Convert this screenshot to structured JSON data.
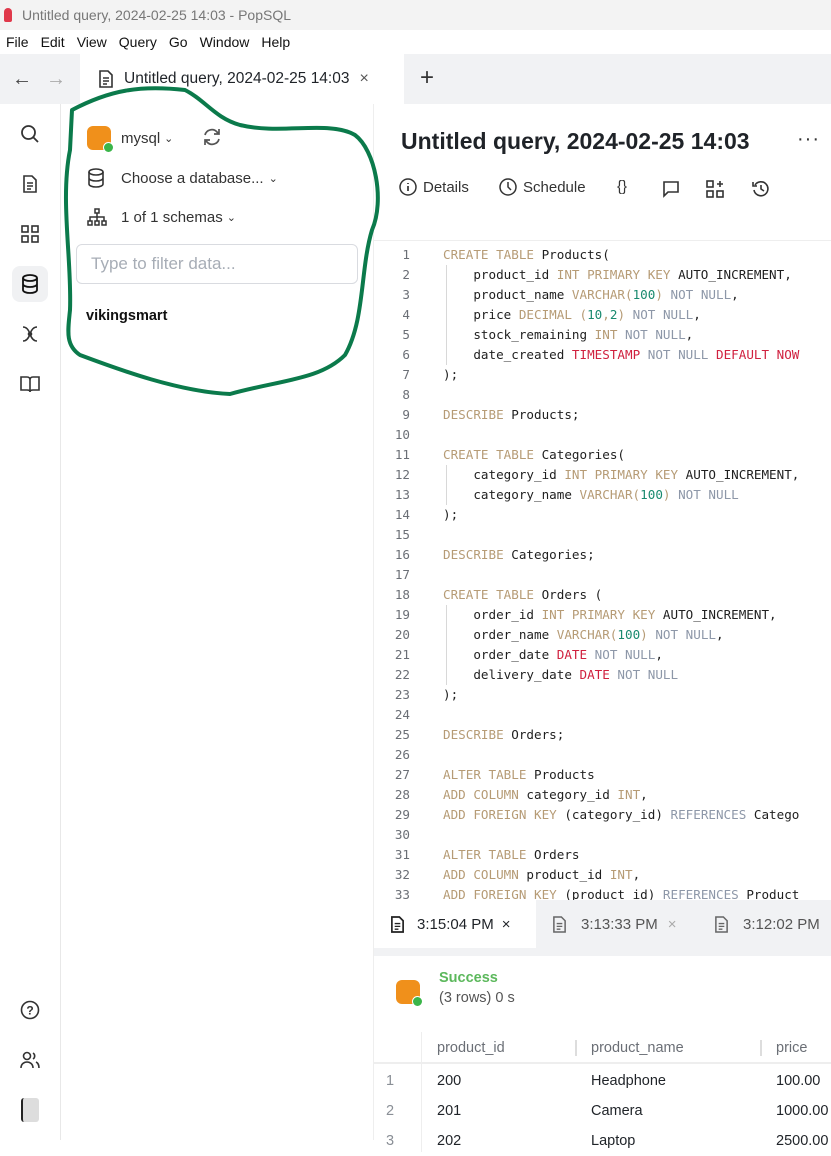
{
  "window": {
    "title": "Untitled query, 2024-02-25 14:03 - PopSQL"
  },
  "menu": [
    "File",
    "Edit",
    "View",
    "Query",
    "Go",
    "Window",
    "Help"
  ],
  "tabs": {
    "active": "Untitled query, 2024-02-25 14:03",
    "close": "×",
    "add": "+"
  },
  "sidebar": {
    "connection": "mysql",
    "database": "Choose a database...",
    "schemas": "1 of 1 schemas",
    "filter_placeholder": "Type to filter data...",
    "schema_item": "vikingsmart"
  },
  "query": {
    "title": "Untitled query, 2024-02-25 14:03",
    "more": "···",
    "toolbar": {
      "details": "Details",
      "schedule": "Schedule",
      "braces": "{}"
    }
  },
  "editor": {
    "lines": [
      [
        [
          "k",
          "CREATE TABLE "
        ],
        [
          "",
          "Products("
        ]
      ],
      [
        [
          "",
          "    product_id "
        ],
        [
          "k",
          "INT PRIMARY KEY "
        ],
        [
          "",
          "AUTO_INCREMENT,"
        ]
      ],
      [
        [
          "",
          "    product_name "
        ],
        [
          "k",
          "VARCHAR("
        ],
        [
          "n",
          "100"
        ],
        [
          "k",
          ") "
        ],
        [
          "g",
          "NOT NULL"
        ],
        [
          "",
          ","
        ]
      ],
      [
        [
          "",
          "    price "
        ],
        [
          "k",
          "DECIMAL ("
        ],
        [
          "n",
          "10"
        ],
        [
          "k",
          ","
        ],
        [
          "n",
          "2"
        ],
        [
          "k",
          ") "
        ],
        [
          "g",
          "NOT NULL"
        ],
        [
          "",
          ","
        ]
      ],
      [
        [
          "",
          "    stock_remaining "
        ],
        [
          "k",
          "INT "
        ],
        [
          "g",
          "NOT NULL"
        ],
        [
          "",
          ","
        ]
      ],
      [
        [
          "",
          "    date_created "
        ],
        [
          "r",
          "TIMESTAMP "
        ],
        [
          "g",
          "NOT NULL "
        ],
        [
          "r",
          "DEFAULT NOW"
        ]
      ],
      [
        [
          "",
          ");"
        ]
      ],
      [],
      [
        [
          "k",
          "DESCRIBE "
        ],
        [
          "",
          "Products;"
        ]
      ],
      [],
      [
        [
          "k",
          "CREATE TABLE "
        ],
        [
          "",
          "Categories("
        ]
      ],
      [
        [
          "",
          "    category_id "
        ],
        [
          "k",
          "INT PRIMARY KEY "
        ],
        [
          "",
          "AUTO_INCREMENT,"
        ]
      ],
      [
        [
          "",
          "    category_name "
        ],
        [
          "k",
          "VARCHAR("
        ],
        [
          "n",
          "100"
        ],
        [
          "k",
          ") "
        ],
        [
          "g",
          "NOT NULL"
        ]
      ],
      [
        [
          "",
          ");"
        ]
      ],
      [],
      [
        [
          "k",
          "DESCRIBE "
        ],
        [
          "",
          "Categories;"
        ]
      ],
      [],
      [
        [
          "k",
          "CREATE TABLE "
        ],
        [
          "",
          "Orders ("
        ]
      ],
      [
        [
          "",
          "    order_id "
        ],
        [
          "k",
          "INT PRIMARY KEY "
        ],
        [
          "",
          "AUTO_INCREMENT,"
        ]
      ],
      [
        [
          "",
          "    order_name "
        ],
        [
          "k",
          "VARCHAR("
        ],
        [
          "n",
          "100"
        ],
        [
          "k",
          ") "
        ],
        [
          "g",
          "NOT NULL"
        ],
        [
          "",
          ","
        ]
      ],
      [
        [
          "",
          "    order_date "
        ],
        [
          "r",
          "DATE "
        ],
        [
          "g",
          "NOT NULL"
        ],
        [
          "",
          ","
        ]
      ],
      [
        [
          "",
          "    delivery_date "
        ],
        [
          "r",
          "DATE "
        ],
        [
          "g",
          "NOT NULL"
        ]
      ],
      [
        [
          "",
          ");"
        ]
      ],
      [],
      [
        [
          "k",
          "DESCRIBE "
        ],
        [
          "",
          "Orders;"
        ]
      ],
      [],
      [
        [
          "k",
          "ALTER TABLE "
        ],
        [
          "",
          "Products"
        ]
      ],
      [
        [
          "k",
          "ADD COLUMN "
        ],
        [
          "",
          "category_id "
        ],
        [
          "k",
          "INT"
        ],
        [
          "",
          ","
        ]
      ],
      [
        [
          "k",
          "ADD FOREIGN KEY "
        ],
        [
          "",
          "(category_id) "
        ],
        [
          "g",
          "REFERENCES "
        ],
        [
          "",
          "Catego"
        ]
      ],
      [],
      [
        [
          "k",
          "ALTER TABLE "
        ],
        [
          "",
          "Orders"
        ]
      ],
      [
        [
          "k",
          "ADD COLUMN "
        ],
        [
          "",
          "product_id "
        ],
        [
          "k",
          "INT"
        ],
        [
          "",
          ","
        ]
      ],
      [
        [
          "k",
          "ADD FOREIGN KEY "
        ],
        [
          "",
          "(product_id) "
        ],
        [
          "g",
          "REFERENCES "
        ],
        [
          "",
          "Product"
        ]
      ]
    ]
  },
  "results": {
    "tabs": [
      {
        "label": "3:15:04 PM",
        "close": "×"
      },
      {
        "label": "3:13:33 PM",
        "close": "×"
      },
      {
        "label": "3:12:02 PM"
      }
    ],
    "status": "Success",
    "summary": "(3 rows) 0 s",
    "columns": [
      "product_id",
      "product_name",
      "price"
    ],
    "rows": [
      [
        "1",
        "200",
        "Headphone",
        "100.00"
      ],
      [
        "2",
        "201",
        "Camera",
        "1000.00"
      ],
      [
        "3",
        "202",
        "Laptop",
        "2500.00"
      ]
    ]
  },
  "colors": {
    "accent_green": "#3bb54a",
    "mysql_orange": "#f0901b",
    "annotation": "#0b7a4b"
  }
}
